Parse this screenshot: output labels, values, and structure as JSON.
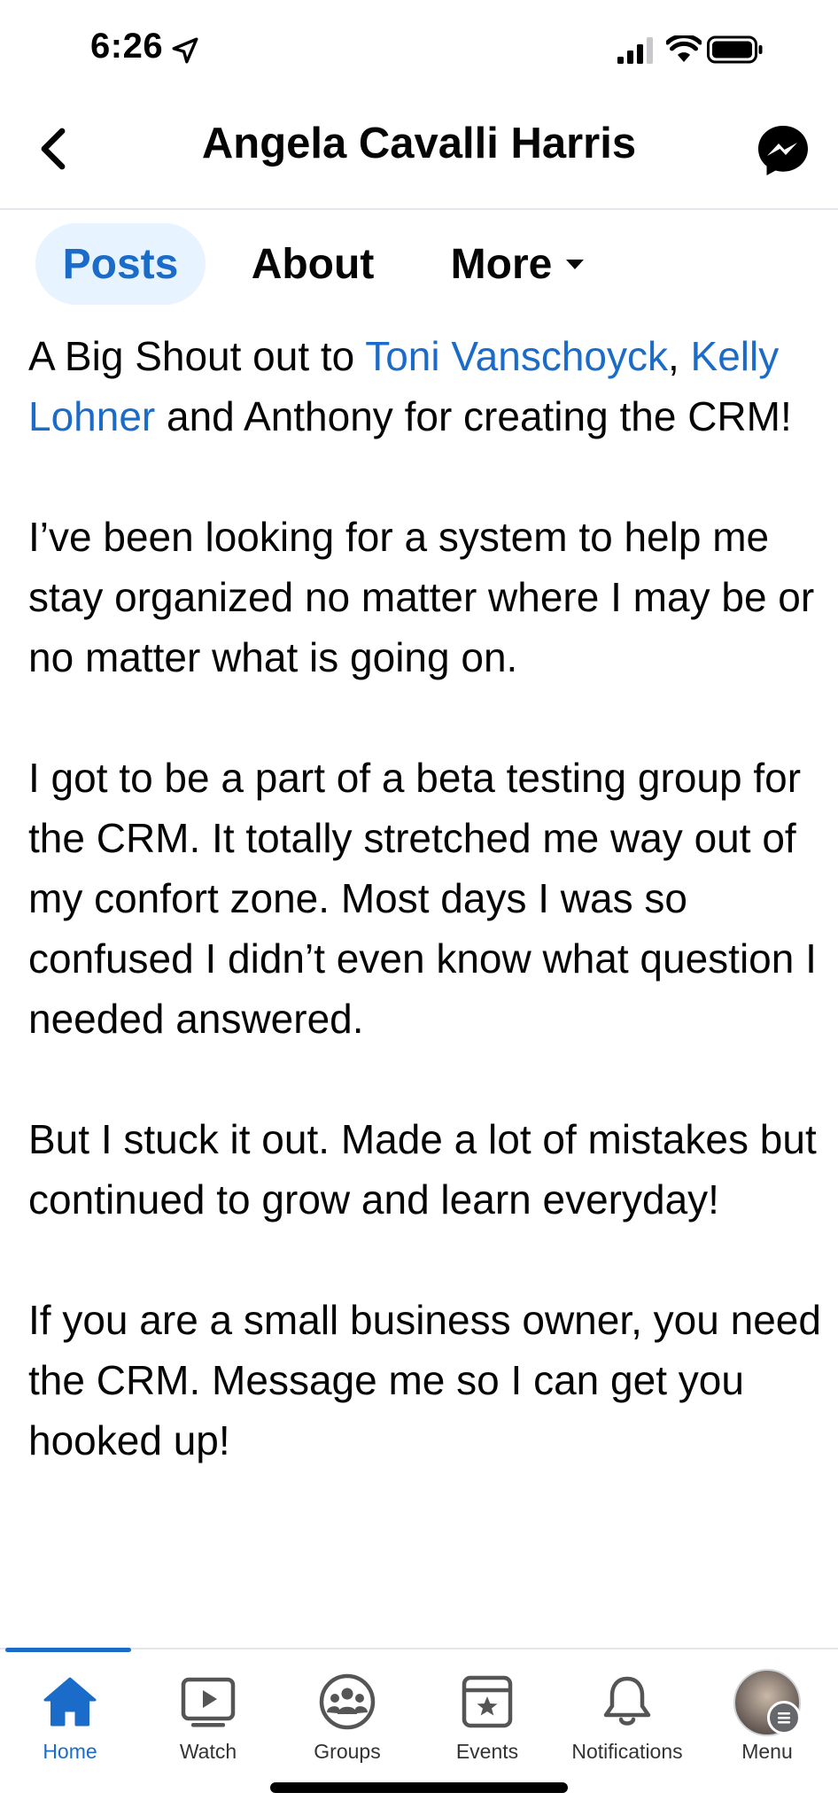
{
  "status_bar": {
    "time": "6:26"
  },
  "header": {
    "title": "Angela Cavalli Harris"
  },
  "tabs": [
    {
      "label": "Posts",
      "active": true
    },
    {
      "label": "About",
      "active": false
    },
    {
      "label": "More",
      "active": false
    }
  ],
  "post": {
    "p1_start": "A Big Shout out to ",
    "mention1": "Toni Vanschoyck",
    "p1_comma": ",",
    "mention2": "Kelly Lohner",
    "p1_end": " and Anthony for creating the CRM!",
    "p2": "I’ve been looking for a system to help me stay organized no matter where I may be or no matter what is going on.",
    "p3": "I got to be a part of a beta testing group for the CRM.  It totally stretched me way out of my confort zone.  Most days I was so confused I didn’t even know what question I needed answered.",
    "p4": "But I stuck it out. Made a lot of mistakes but continued to grow and learn everyday!",
    "p5": "If you are a small business owner,  you need the CRM.  Message me so I can get you hooked up!"
  },
  "bottom_nav": [
    {
      "label": "Home",
      "icon": "home-icon",
      "active": true
    },
    {
      "label": "Watch",
      "icon": "watch-icon",
      "active": false
    },
    {
      "label": "Groups",
      "icon": "groups-icon",
      "active": false
    },
    {
      "label": "Events",
      "icon": "events-icon",
      "active": false
    },
    {
      "label": "Notifications",
      "icon": "bell-icon",
      "active": false
    },
    {
      "label": "Menu",
      "icon": "avatar",
      "active": false
    }
  ],
  "colors": {
    "accent": "#1b6bc9",
    "active_tab_bg": "#e7f3ff",
    "text": "#050505"
  }
}
